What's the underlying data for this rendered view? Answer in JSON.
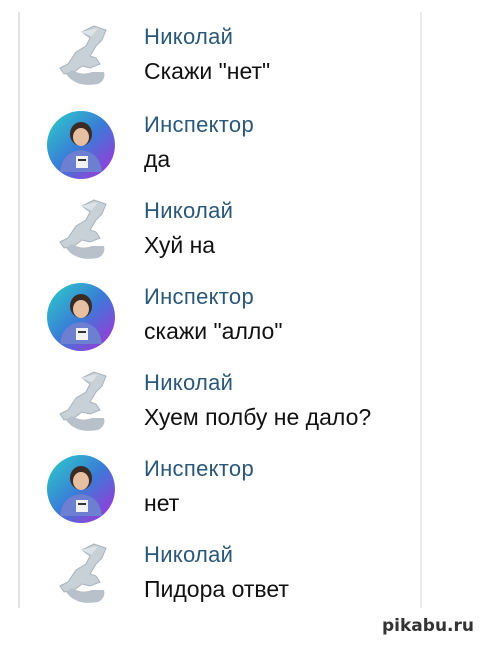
{
  "messages": [
    {
      "author": "Николай",
      "text": "Скажи \"нет\"",
      "avatar": "axe-statue-icon"
    },
    {
      "author": "Инспектор",
      "text": "да",
      "avatar": "inspector-avatar"
    },
    {
      "author": "Николай",
      "text": "Хуй на",
      "avatar": "axe-statue-icon"
    },
    {
      "author": "Инспектор",
      "text": "скажи \"алло\"",
      "avatar": "inspector-avatar"
    },
    {
      "author": "Николай",
      "text": "Хуем полбу не дало?",
      "avatar": "axe-statue-icon"
    },
    {
      "author": "Инспектор",
      "text": "нет",
      "avatar": "inspector-avatar"
    },
    {
      "author": "Николай",
      "text": "Пидора ответ",
      "avatar": "axe-statue-icon"
    }
  ],
  "watermark": "pikabu.ru",
  "colors": {
    "author": "#2b587a",
    "text": "#111111",
    "background": "#ffffff"
  }
}
